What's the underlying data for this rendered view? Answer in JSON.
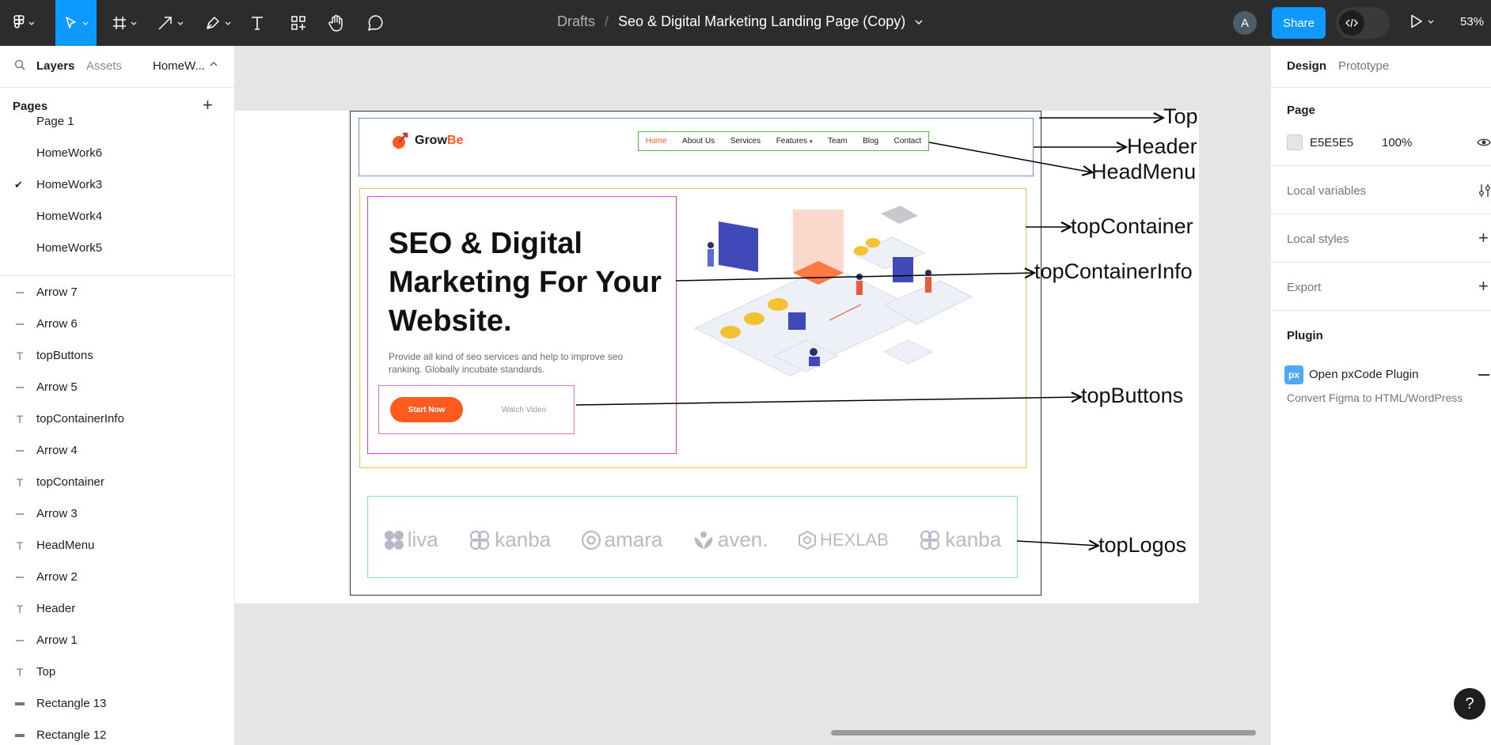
{
  "toolbar": {
    "breadcrumb_parent": "Drafts",
    "breadcrumb_sep": "/",
    "file_title": "Seo & Digital Marketing Landing Page (Copy)",
    "avatar_initial": "A",
    "share_label": "Share",
    "zoom": "53%",
    "dev_mode_icon": "code-icon",
    "accent_color": "#0d99ff"
  },
  "left_panel": {
    "tab_layers": "Layers",
    "tab_assets": "Assets",
    "current_page_short": "HomeW...",
    "pages_title": "Pages",
    "pages": [
      {
        "label": "Page 1",
        "selected": false
      },
      {
        "label": "HomeWork6",
        "selected": false
      },
      {
        "label": "HomeWork3",
        "selected": true
      },
      {
        "label": "HomeWork4",
        "selected": false
      },
      {
        "label": "HomeWork5",
        "selected": false
      }
    ],
    "layers": [
      {
        "label": "Arrow 7",
        "type": "line"
      },
      {
        "label": "Arrow 6",
        "type": "line"
      },
      {
        "label": "topButtons",
        "type": "text"
      },
      {
        "label": "Arrow 5",
        "type": "line"
      },
      {
        "label": "topContainerInfo",
        "type": "text"
      },
      {
        "label": "Arrow 4",
        "type": "line"
      },
      {
        "label": "topContainer",
        "type": "text"
      },
      {
        "label": "Arrow 3",
        "type": "line"
      },
      {
        "label": "HeadMenu",
        "type": "text"
      },
      {
        "label": "Arrow 2",
        "type": "line"
      },
      {
        "label": "Header",
        "type": "text"
      },
      {
        "label": "Arrow 1",
        "type": "line"
      },
      {
        "label": "Top",
        "type": "text"
      },
      {
        "label": "Rectangle 13",
        "type": "rect"
      },
      {
        "label": "Rectangle 12",
        "type": "rect"
      }
    ]
  },
  "canvas": {
    "logo_text_main": "Grow",
    "logo_text_accent": "Be",
    "menu": [
      "Home",
      "About Us",
      "Services",
      "Features",
      "Team",
      "Blog",
      "Contact"
    ],
    "hero_title": "SEO & Digital Marketing For Your Website.",
    "hero_sub": "Provide all kind of seo services and help to improve seo ranking. Globally incubate standards.",
    "btn_start": "Start Now",
    "btn_watch": "Watch Video",
    "brands": [
      "liva",
      "kanba",
      "amara",
      "aven.",
      "HEXLAB",
      "kanba"
    ],
    "annotations": {
      "top": "Top",
      "header": "Header",
      "headmenu": "HeadMenu",
      "topcontainer": "topContainer",
      "topcontainerinfo": "topContainerInfo",
      "topbuttons": "topButtons",
      "toplogos": "topLogos"
    },
    "brand_orange": "#ff5a1f"
  },
  "right_panel": {
    "tab_design": "Design",
    "tab_prototype": "Prototype",
    "page_section": "Page",
    "page_color_hex": "E5E5E5",
    "page_opacity": "100%",
    "local_variables": "Local variables",
    "local_styles": "Local styles",
    "export": "Export",
    "plugin_title": "Plugin",
    "plugin_badge": "px",
    "plugin_name": "Open pxCode Plugin",
    "plugin_desc": "Convert Figma to HTML/WordPress"
  },
  "help_label": "?"
}
